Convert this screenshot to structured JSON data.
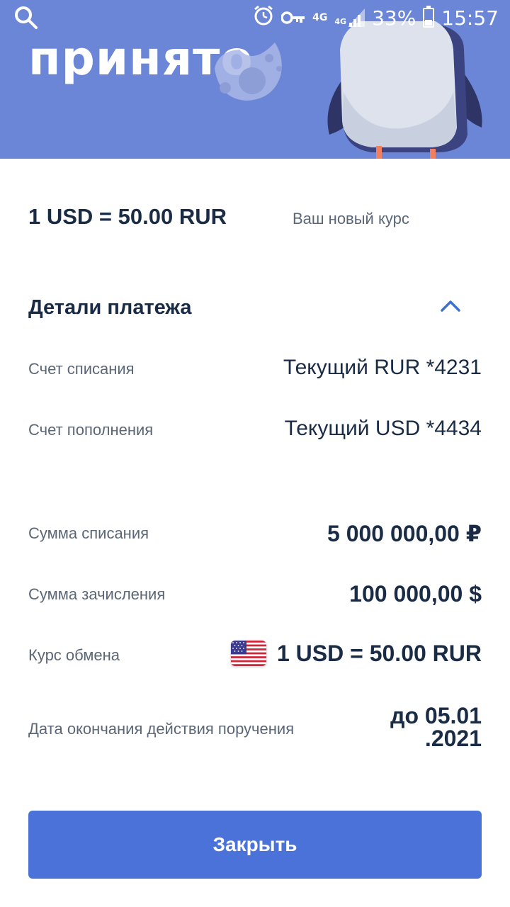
{
  "status_bar": {
    "network_1": "4G",
    "network_2": "4G",
    "battery": "33%",
    "time": "15:57"
  },
  "hero": {
    "title": "принято"
  },
  "rate": {
    "main": "1 USD = 50.00 RUR",
    "note": "Ваш новый курс"
  },
  "details": {
    "title": "Детали платежа",
    "rows": [
      {
        "label": "Счет списания",
        "value": "Текущий RUR *4231"
      },
      {
        "label": "Счет пополнения",
        "value": "Текущий USD *4434"
      },
      {
        "label": "Сумма списания",
        "value": "5 000 000,00 ₽"
      },
      {
        "label": "Сумма зачисления",
        "value": "100 000,00 $"
      },
      {
        "label": "Курс обмена",
        "value": "1 USD = 50.00 RUR"
      },
      {
        "label": "Дата окончания действия поручения",
        "value_line1": "до 05.01",
        "value_line2": ".2021"
      }
    ]
  },
  "actions": {
    "close_label": "Закрыть"
  },
  "colors": {
    "hero_bg": "#6b86d6",
    "button_bg": "#4a72d9",
    "text_dark": "#1a2b45",
    "text_muted": "#5b6777"
  }
}
